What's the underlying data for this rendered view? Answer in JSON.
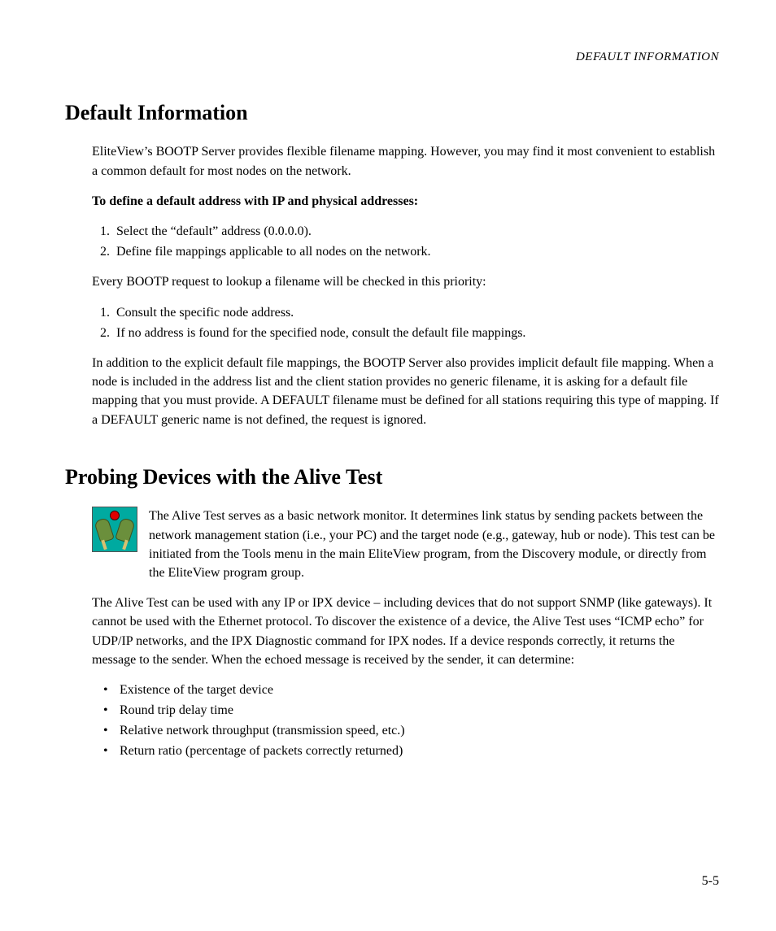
{
  "runningHead": "DEFAULT INFORMATION",
  "section1": {
    "title": "Default Information",
    "intro": "EliteView’s BOOTP Server provides flexible filename mapping. However, you may find it most convenient to establish a common default for most nodes on the network.",
    "procTitle": "To define a default address with IP and physical addresses:",
    "steps": [
      "Select the “default” address (0.0.0.0).",
      "Define file mappings applicable to all nodes on the network."
    ],
    "priorityIntro": "Every BOOTP request to lookup a filename will be checked in this priority:",
    "priority": [
      "Consult the specific node address.",
      "If no address is found for the specified node, consult the default file mappings."
    ],
    "tail": "In addition to the explicit default file mappings, the BOOTP Server also provides implicit default file mapping. When a node is included in the address list and the client station provides no generic filename, it is asking for a default file mapping that you must provide. A DEFAULT filename must be defined for all stations requiring this type of mapping. If a DEFAULT generic name is not defined, the request is ignored."
  },
  "section2": {
    "title": "Probing Devices with the Alive Test",
    "iconPara": "The Alive Test serves as a basic network monitor. It determines link status by sending packets between the network management station (i.e., your PC) and the target node (e.g., gateway, hub or node). This test can be initiated from the Tools menu in the main EliteView program, from the Discovery module, or directly from the EliteView program group.",
    "para2": "The Alive Test can be used with any IP or IPX device – including devices that do not support SNMP (like gateways). It cannot be used with the Ethernet protocol. To discover the existence of a device, the Alive Test uses “ICMP echo” for UDP/IP networks, and the IPX Diagnostic command for IPX nodes. If a device responds correctly, it returns the message to the sender. When the echoed message is received by the sender, it can determine:",
    "bullets": [
      "Existence of the target device",
      "Round trip delay time",
      "Relative network throughput (transmission speed, etc.)",
      "Return ratio (percentage of packets correctly returned)"
    ]
  },
  "pageNumber": "5-5"
}
